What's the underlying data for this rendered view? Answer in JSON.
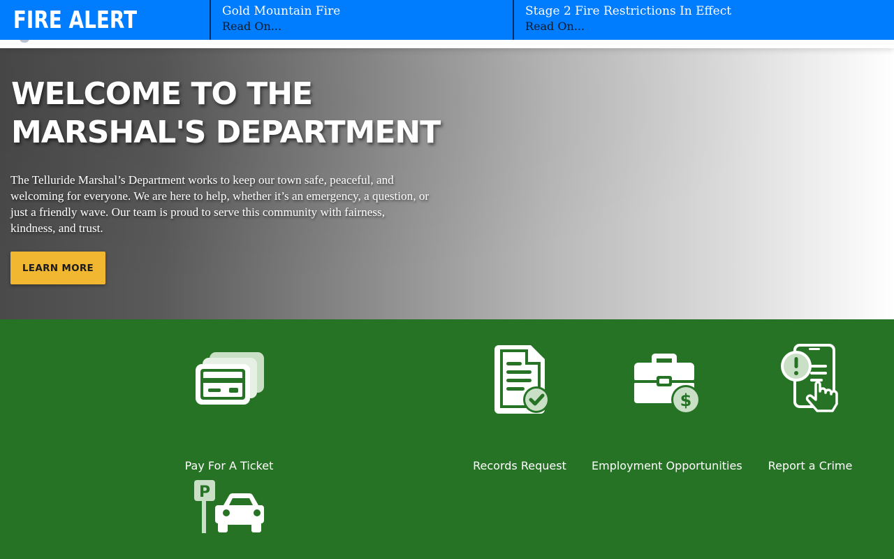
{
  "alert_bar": {
    "title": "FIRE ALERT",
    "items": [
      {
        "headline": "Gold Mountain Fire",
        "link": "Read On..."
      },
      {
        "headline": "Stage 2 Fire Restrictions In Effect",
        "link": "Read On..."
      }
    ]
  },
  "hero": {
    "title_line1": "WELCOME TO THE",
    "title_line2": "MARSHAL'S DEPARTMENT",
    "body": "The Telluride Marshal’s Department works to keep our town safe, peaceful, and welcoming for everyone. We are here to help, whether it’s an emergency, a question, or just a friendly wave. Our team is proud to serve this community with fairness, kindness, and trust.",
    "button_label": "LEARN MORE"
  },
  "services": {
    "items": [
      {
        "label": "Pay For A Ticket",
        "icon": "credit-card-icon"
      },
      {
        "label": "Records Request",
        "icon": "document-check-icon"
      },
      {
        "label": "Employment Opportunities",
        "icon": "briefcase-dollar-icon"
      },
      {
        "label": "Report a Crime",
        "icon": "phone-alert-icon"
      },
      {
        "label": "",
        "icon": "parking-car-icon"
      }
    ]
  },
  "colors": {
    "alert_blue": "#007cff",
    "services_green": "#277326",
    "button_yellow": "#f1b730",
    "icon_light_green": "#c9dfc6"
  }
}
